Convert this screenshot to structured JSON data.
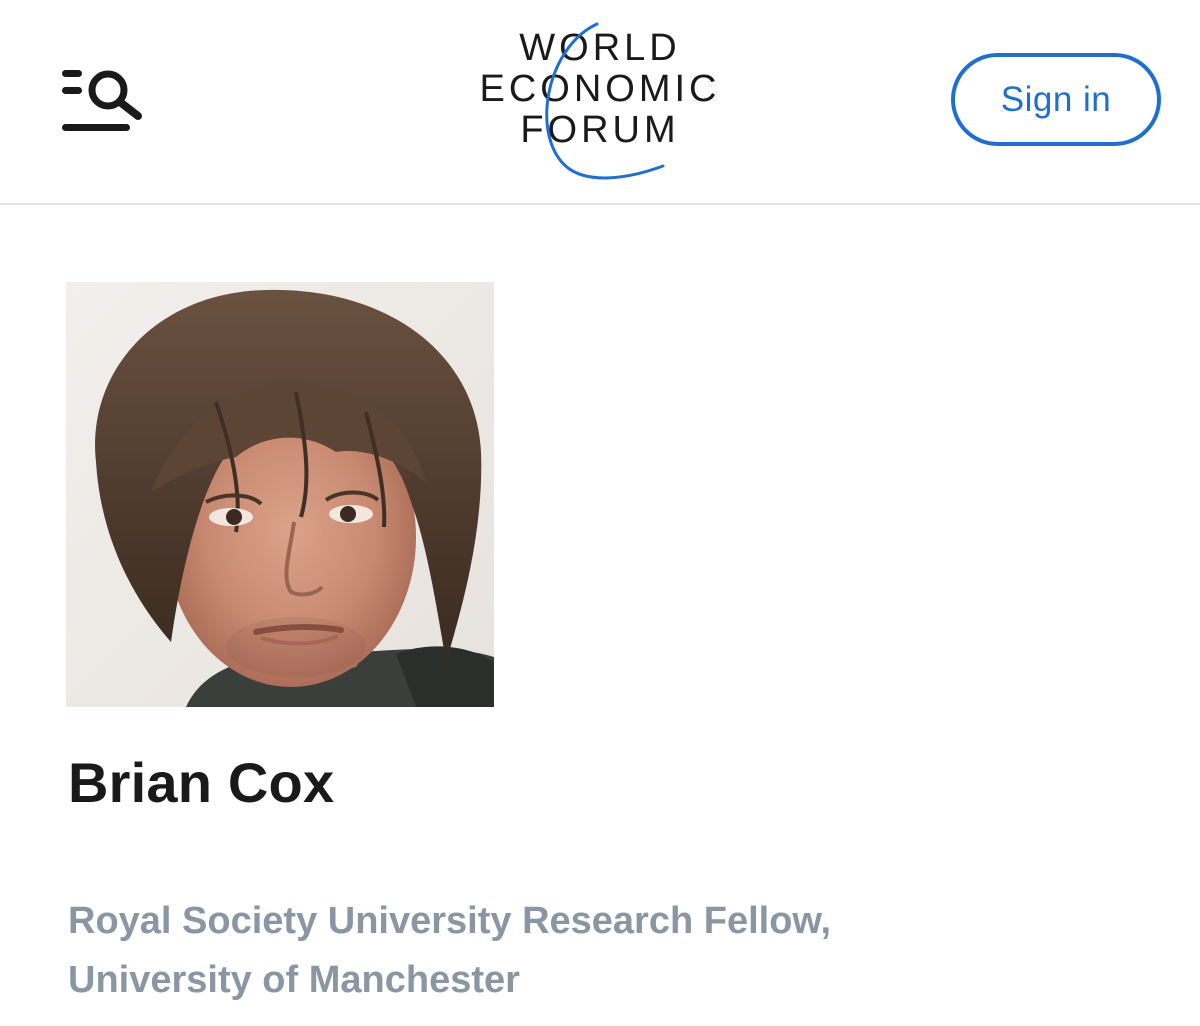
{
  "header": {
    "logo_lines": [
      "WORLD",
      "ECONOMIC",
      "FORUM"
    ],
    "sign_in_label": "Sign in",
    "menu_icon": "menu-search-icon"
  },
  "profile": {
    "name": "Brian Cox",
    "affiliation_lines": [
      "Royal Society University Research Fellow,",
      "University of Manchester"
    ]
  },
  "colors": {
    "accent": "#1f6fd1",
    "name_text": "#1a1a1a",
    "affiliation_text": "#8a96a3",
    "divider": "#e3e3e3"
  }
}
